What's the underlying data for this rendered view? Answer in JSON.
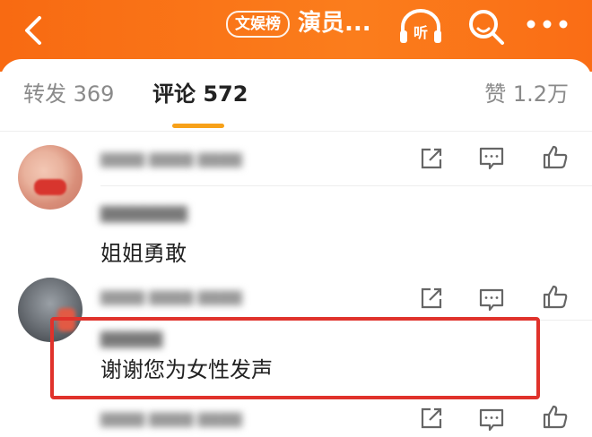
{
  "header": {
    "tag": "文娱榜",
    "title": "演员...",
    "icons": [
      "back-icon",
      "listen-icon",
      "search-icon",
      "more-icon"
    ],
    "listen_label": "听",
    "accent_color": "#f86a12"
  },
  "tabs": {
    "repost_label": "转发",
    "repost_count": "369",
    "comments_label": "评论",
    "comments_count": "572",
    "likes_label": "赞",
    "likes_count": "1.2万",
    "active": "comments",
    "indicator_color": "#f7a119"
  },
  "comments": [
    {
      "username": "",
      "text": "",
      "meta": "",
      "actions": [
        "share-icon",
        "comment-icon",
        "like-icon"
      ]
    },
    {
      "username": "",
      "text": "姐姐勇敢",
      "meta": "",
      "actions": [
        "share-icon",
        "comment-icon",
        "like-icon"
      ]
    },
    {
      "username": "",
      "text": "谢谢您为女性发声",
      "meta": "",
      "highlighted": true,
      "actions": [
        "share-icon",
        "comment-icon",
        "like-icon"
      ]
    }
  ],
  "highlight_color": "#e0322b"
}
